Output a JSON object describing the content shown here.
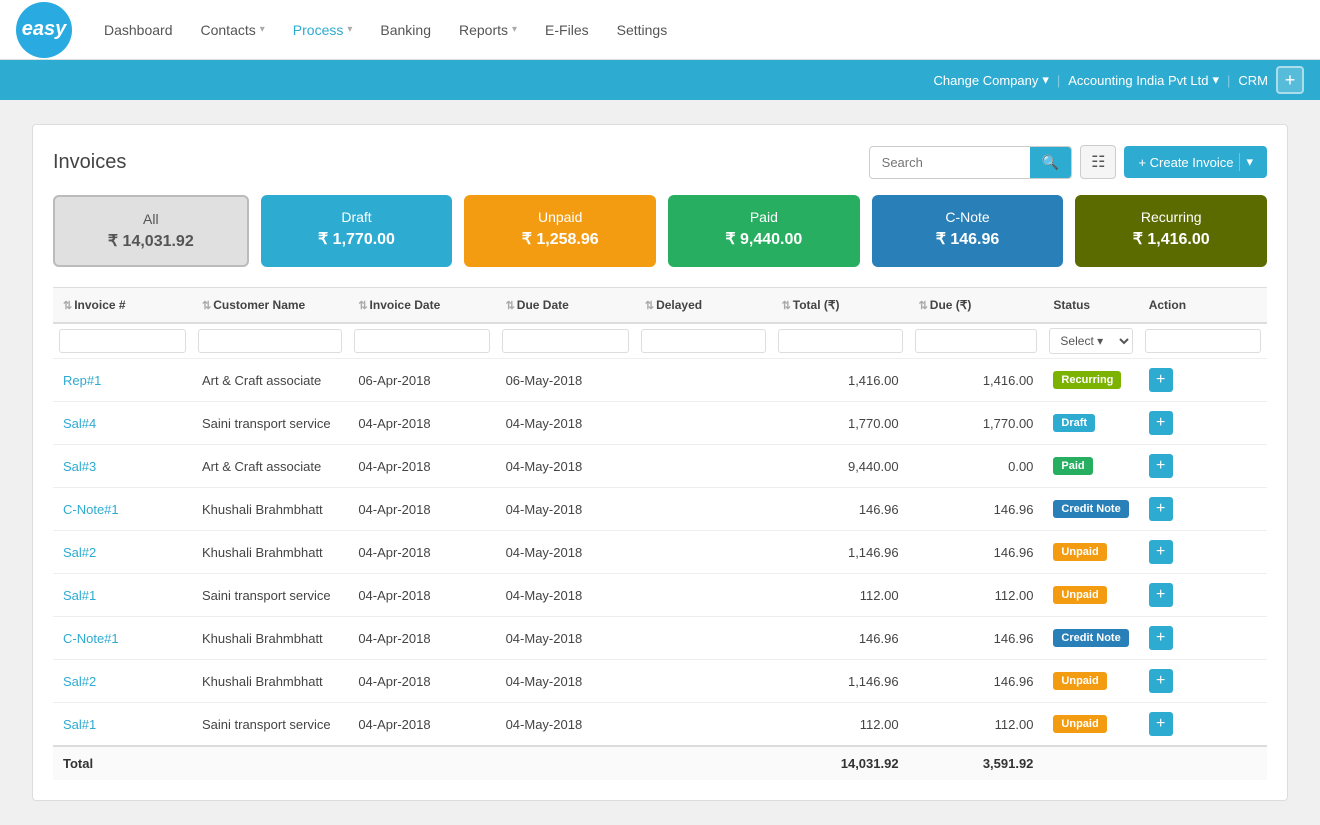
{
  "logo": {
    "text": "easy"
  },
  "nav": {
    "items": [
      {
        "label": "Dashboard",
        "active": false,
        "hasDropdown": false
      },
      {
        "label": "Contacts",
        "active": false,
        "hasDropdown": true
      },
      {
        "label": "Process",
        "active": true,
        "hasDropdown": true
      },
      {
        "label": "Banking",
        "active": false,
        "hasDropdown": false
      },
      {
        "label": "Reports",
        "active": false,
        "hasDropdown": true
      },
      {
        "label": "E-Files",
        "active": false,
        "hasDropdown": false
      },
      {
        "label": "Settings",
        "active": false,
        "hasDropdown": false
      }
    ]
  },
  "topbar": {
    "change_company": "Change Company",
    "company_name": "Accounting India Pvt Ltd",
    "crm": "CRM"
  },
  "page": {
    "title": "Invoices",
    "search_placeholder": "Search",
    "create_button": "+ Create Invoice"
  },
  "tiles": [
    {
      "key": "all",
      "label": "All",
      "amount": "₹ 14,031.92",
      "class": "all"
    },
    {
      "key": "draft",
      "label": "Draft",
      "amount": "₹ 1,770.00",
      "class": "draft"
    },
    {
      "key": "unpaid",
      "label": "Unpaid",
      "amount": "₹ 1,258.96",
      "class": "unpaid"
    },
    {
      "key": "paid",
      "label": "Paid",
      "amount": "₹ 9,440.00",
      "class": "paid"
    },
    {
      "key": "cnote",
      "label": "C-Note",
      "amount": "₹ 146.96",
      "class": "cnote"
    },
    {
      "key": "recurring",
      "label": "Recurring",
      "amount": "₹ 1,416.00",
      "class": "recurring"
    }
  ],
  "table": {
    "columns": [
      {
        "label": "Invoice #",
        "key": "invoice_num",
        "sortable": true
      },
      {
        "label": "Customer Name",
        "key": "customer_name",
        "sortable": true
      },
      {
        "label": "Invoice Date",
        "key": "invoice_date",
        "sortable": true
      },
      {
        "label": "Due Date",
        "key": "due_date",
        "sortable": true
      },
      {
        "label": "Delayed",
        "key": "delayed",
        "sortable": true
      },
      {
        "label": "Total (₹)",
        "key": "total",
        "sortable": true
      },
      {
        "label": "Due (₹)",
        "key": "due",
        "sortable": true
      },
      {
        "label": "Status",
        "key": "status",
        "sortable": false
      },
      {
        "label": "Action",
        "key": "action",
        "sortable": false
      }
    ],
    "filter_select_placeholder": "Select ▾",
    "rows": [
      {
        "invoice_num": "Rep#1",
        "customer_name": "Art & Craft associate",
        "invoice_date": "06-Apr-2018",
        "due_date": "06-May-2018",
        "delayed": "",
        "total": "1,416.00",
        "due": "1,416.00",
        "status": "Recurring",
        "status_class": "badge-recurring"
      },
      {
        "invoice_num": "Sal#4",
        "customer_name": "Saini transport service",
        "invoice_date": "04-Apr-2018",
        "due_date": "04-May-2018",
        "delayed": "",
        "total": "1,770.00",
        "due": "1,770.00",
        "status": "Draft",
        "status_class": "badge-draft"
      },
      {
        "invoice_num": "Sal#3",
        "customer_name": "Art & Craft associate",
        "invoice_date": "04-Apr-2018",
        "due_date": "04-May-2018",
        "delayed": "",
        "total": "9,440.00",
        "due": "0.00",
        "status": "Paid",
        "status_class": "badge-paid"
      },
      {
        "invoice_num": "C-Note#1",
        "customer_name": "Khushali Brahmbhatt",
        "invoice_date": "04-Apr-2018",
        "due_date": "04-May-2018",
        "delayed": "",
        "total": "146.96",
        "due": "146.96",
        "status": "Credit Note",
        "status_class": "badge-credit-note"
      },
      {
        "invoice_num": "Sal#2",
        "customer_name": "Khushali Brahmbhatt",
        "invoice_date": "04-Apr-2018",
        "due_date": "04-May-2018",
        "delayed": "",
        "total": "1,146.96",
        "due": "146.96",
        "status": "Unpaid",
        "status_class": "badge-unpaid"
      },
      {
        "invoice_num": "Sal#1",
        "customer_name": "Saini transport service",
        "invoice_date": "04-Apr-2018",
        "due_date": "04-May-2018",
        "delayed": "",
        "total": "112.00",
        "due": "112.00",
        "status": "Unpaid",
        "status_class": "badge-unpaid"
      },
      {
        "invoice_num": "C-Note#1",
        "customer_name": "Khushali Brahmbhatt",
        "invoice_date": "04-Apr-2018",
        "due_date": "04-May-2018",
        "delayed": "",
        "total": "146.96",
        "due": "146.96",
        "status": "Credit Note",
        "status_class": "badge-credit-note"
      },
      {
        "invoice_num": "Sal#2",
        "customer_name": "Khushali Brahmbhatt",
        "invoice_date": "04-Apr-2018",
        "due_date": "04-May-2018",
        "delayed": "",
        "total": "1,146.96",
        "due": "146.96",
        "status": "Unpaid",
        "status_class": "badge-unpaid"
      },
      {
        "invoice_num": "Sal#1",
        "customer_name": "Saini transport service",
        "invoice_date": "04-Apr-2018",
        "due_date": "04-May-2018",
        "delayed": "",
        "total": "112.00",
        "due": "112.00",
        "status": "Unpaid",
        "status_class": "badge-unpaid"
      }
    ],
    "total_label": "Total",
    "total_amount": "14,031.92",
    "total_due": "3,591.92"
  }
}
